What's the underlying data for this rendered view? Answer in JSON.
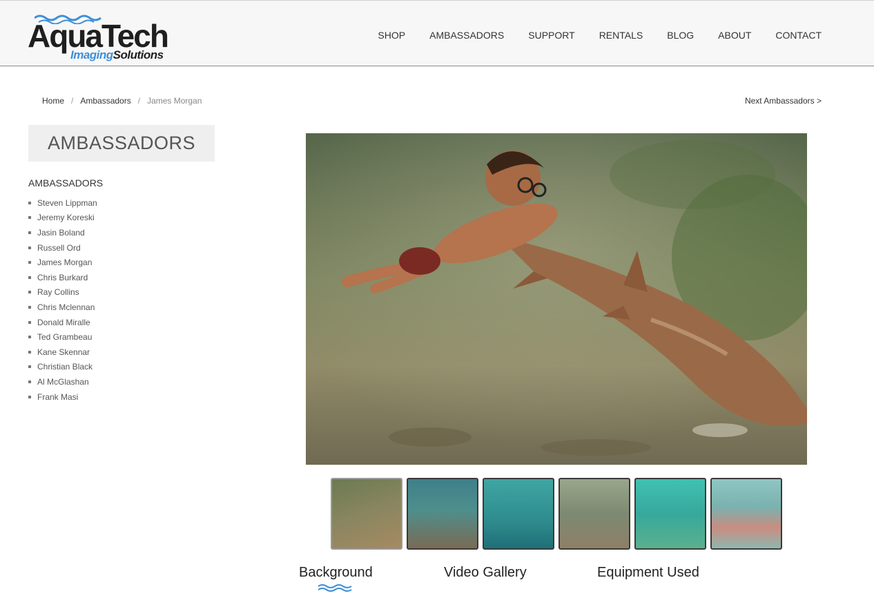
{
  "brand": {
    "name_main": "AquaTech",
    "name_sub_1": "Imaging",
    "name_sub_2": "Solutions",
    "accent_color": "#3e8fd8"
  },
  "nav": {
    "items": [
      "SHOP",
      "AMBASSADORS",
      "SUPPORT",
      "RENTALS",
      "BLOG",
      "ABOUT",
      "CONTACT"
    ]
  },
  "breadcrumb": {
    "home": "Home",
    "section": "Ambassadors",
    "current": "James Morgan",
    "separator": "/"
  },
  "next_link": "Next Ambassadors >",
  "sidebar": {
    "box_title": "AMBASSADORS",
    "heading": "AMBASSADORS",
    "items": [
      "Steven Lippman",
      "Jeremy Koreski",
      "Jasin Boland",
      "Russell Ord",
      "James Morgan",
      "Chris Burkard",
      "Ray Collins",
      "Chris Mclennan",
      "Donald Miralle",
      "Ted Grambeau",
      "Kane Skennar",
      "Christian Black",
      "Al McGlashan",
      "Frank Masi"
    ]
  },
  "gallery": {
    "thumb_count": 6,
    "active_index": 0
  },
  "tabs": [
    "Background",
    "Video Gallery",
    "Equipment Used"
  ]
}
